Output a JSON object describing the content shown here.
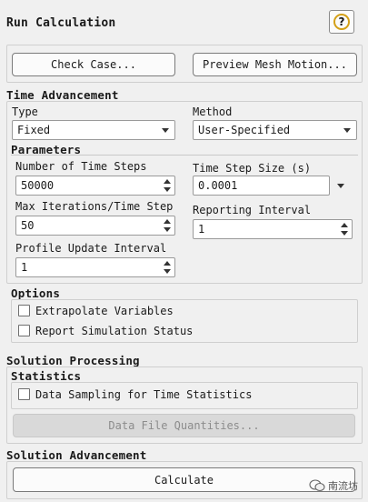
{
  "dialog": {
    "title": "Run Calculation",
    "help_icon": "question-icon",
    "help_glyph": "?"
  },
  "top_buttons": {
    "check_case": "Check Case...",
    "preview_mesh": "Preview Mesh Motion..."
  },
  "time_advancement": {
    "heading": "Time Advancement",
    "type_label": "Type",
    "type_value": "Fixed",
    "method_label": "Method",
    "method_value": "User-Specified"
  },
  "parameters": {
    "heading": "Parameters",
    "num_steps_label": "Number of Time Steps",
    "num_steps_value": "50000",
    "step_size_label": "Time Step Size (s)",
    "step_size_value": "0.0001",
    "max_iter_label": "Max Iterations/Time Step",
    "max_iter_value": "50",
    "reporting_label": "Reporting Interval",
    "reporting_value": "1",
    "profile_label": "Profile Update Interval",
    "profile_value": "1"
  },
  "options": {
    "heading": "Options",
    "extrapolate": "Extrapolate Variables",
    "report_status": "Report Simulation Status"
  },
  "solution_processing": {
    "heading": "Solution Processing",
    "statistics_heading": "Statistics",
    "data_sampling": "Data Sampling for Time Statistics",
    "data_file_btn": "Data File Quantities..."
  },
  "solution_advancement": {
    "heading": "Solution Advancement",
    "calculate": "Calculate"
  },
  "watermark": {
    "text": "南流坊"
  }
}
